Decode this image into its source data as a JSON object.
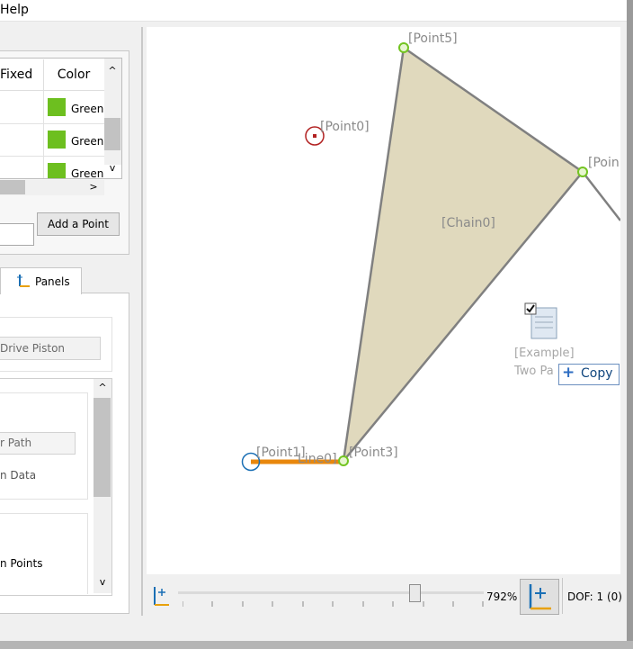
{
  "menubar": {
    "help": "Help"
  },
  "points_table": {
    "headers": [
      "Fixed",
      "Color"
    ],
    "rows": [
      {
        "color_label": "Green",
        "color": "#6dbf1f"
      },
      {
        "color_label": "Green",
        "color": "#6dbf1f"
      },
      {
        "color_label": "G",
        "color": "#6dbf1f"
      }
    ],
    "scroll_up": "^",
    "scroll_down": "v",
    "scroll_right": ">"
  },
  "add_point": {
    "input_value": "",
    "button": "Add a Point"
  },
  "tabs": {
    "panels": "Panels"
  },
  "panel": {
    "drive_piston": "Drive Piston",
    "path_field": "r Path",
    "data_label": "n Data",
    "points_label": "n Points"
  },
  "canvas": {
    "labels": {
      "point0": "[Point0]",
      "point1": "[Point1]",
      "point3": "[Point3]",
      "point5": "[Point5]",
      "point4": "[Poin",
      "line0": "Line0]",
      "chain0": "[Chain0]"
    },
    "colors": {
      "chain_fill": "#e0d9bd",
      "line_orange": "#e8870c",
      "point_green": "#73c421",
      "point_red": "#b22222",
      "point_blue": "#1a6fb5"
    },
    "drag_file": {
      "line1": "[Example]",
      "line2": "Two Pa"
    },
    "copy_tooltip": "Copy"
  },
  "toolbar": {
    "zoom": "792%",
    "dof": "DOF: 1 (0)"
  }
}
